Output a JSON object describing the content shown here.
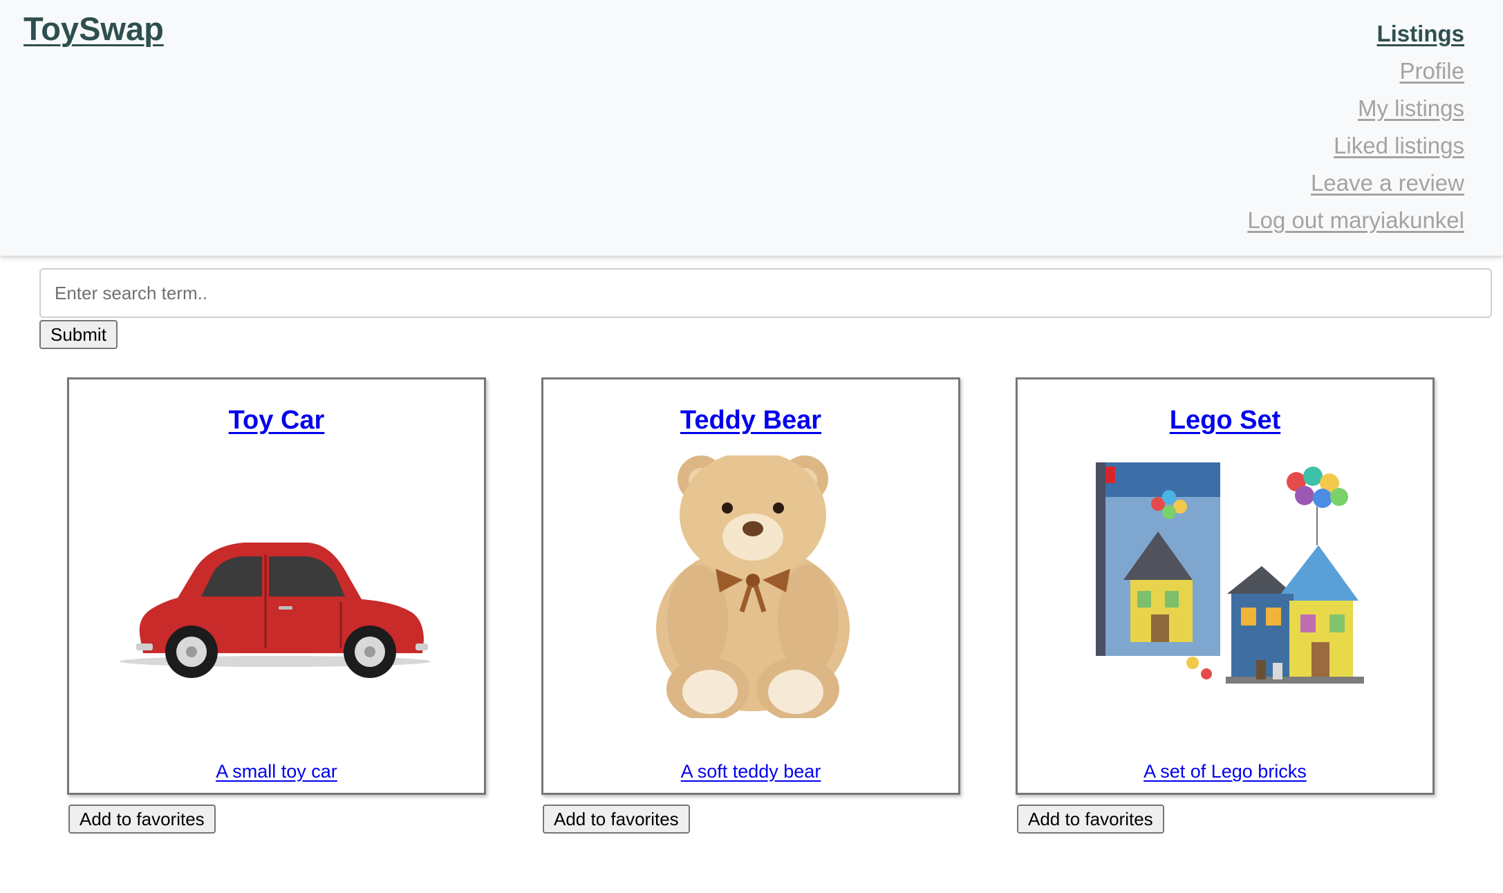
{
  "header": {
    "brand": "ToySwap",
    "nav": [
      {
        "label": "Listings",
        "active": true
      },
      {
        "label": "Profile"
      },
      {
        "label": "My listings"
      },
      {
        "label": "Liked listings"
      },
      {
        "label": "Leave a review"
      },
      {
        "label": "Log out maryiakunkel"
      }
    ]
  },
  "search": {
    "placeholder": "Enter search term..",
    "value": "",
    "submit_label": "Submit"
  },
  "listings": [
    {
      "title": "Toy Car",
      "description": "A small toy car",
      "image": "red-toy-car-image",
      "favorite_label": "Add to favorites"
    },
    {
      "title": "Teddy Bear",
      "description": "A soft teddy bear",
      "image": "teddy-bear-image",
      "favorite_label": "Add to favorites"
    },
    {
      "title": "Lego Set",
      "description": "A set of Lego bricks",
      "image": "lego-disney-up-house-image",
      "favorite_label": "Add to favorites"
    }
  ],
  "colors": {
    "header_bg": "#f8f9fa",
    "brand": "#2f4f4f",
    "nav_inactive": "#a3a3a3",
    "link": "#0000ee"
  }
}
